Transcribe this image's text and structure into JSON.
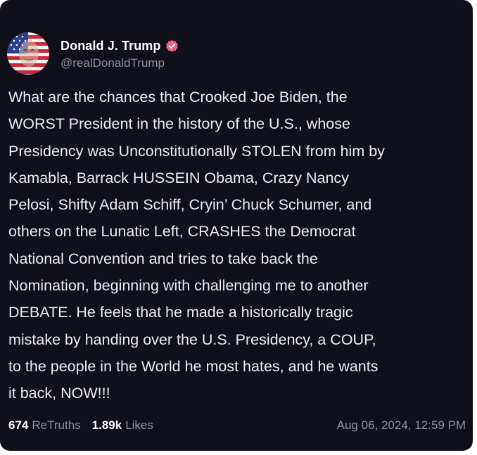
{
  "post": {
    "display_name": "Donald J. Trump",
    "handle": "@realDonaldTrump",
    "verified_icon": "verified-badge-icon",
    "text": "What are the chances that Crooked Joe Biden, the\nWORST President in the history of the U.S., whose\nPresidency was Unconstitutionally STOLEN from him by\nKamabla, Barrack HUSSEIN Obama, Crazy Nancy\nPelosi, Shifty Adam Schiff, Cryin’ Chuck Schumer, and\nothers on the Lunatic Left, CRASHES the Democrat\nNational Convention and tries to take back the\nNomination, beginning with challenging me to another\nDEBATE. He feels that he made a historically tragic\nmistake by handing over the U.S. Presidency, a COUP,\nto the people in the World he most hates, and he wants\nit back, NOW!!!",
    "retruths_count": "674",
    "retruths_label": "ReTruths",
    "likes_count": "1.89k",
    "likes_label": "Likes",
    "timestamp": "Aug 06, 2024, 12:59 PM"
  },
  "colors": {
    "background": "#10101a",
    "text": "#ececf2",
    "muted": "#8f8f9e",
    "verified": "#e8627f"
  }
}
